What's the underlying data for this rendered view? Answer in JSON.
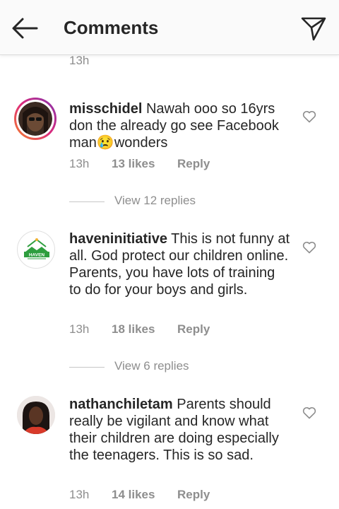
{
  "header": {
    "title": "Comments",
    "back_icon": "back-arrow-icon",
    "send_icon": "paper-plane-icon"
  },
  "top_item": {
    "time": "13h"
  },
  "comments": [
    {
      "username": "misschidel",
      "text_part1": "Nawah ooo so 16yrs don the already go see Facebook man",
      "emoji": "😢",
      "text_part2": "wonders",
      "time": "13h",
      "likes": "13 likes",
      "reply": "Reply",
      "view_replies": "View 12 replies"
    },
    {
      "username": "haveninitiative",
      "text": "This is not funny at all. God protect our children online. Parents, you have lots of training to do for your boys and girls.",
      "time": "13h",
      "likes": "18 likes",
      "reply": "Reply",
      "view_replies": "View 6 replies",
      "avatar_text": "HAVEN"
    },
    {
      "username": "nathanchiletam",
      "text": "Parents should really be vigilant and know what their children are doing especially the teenagers. This is so sad.",
      "time": "13h",
      "likes": "14 likes",
      "reply": "Reply"
    }
  ],
  "colors": {
    "text": "#262626",
    "meta": "#8e8e8e",
    "story_ring_start": "#f58529",
    "story_ring_end": "#dd2a7b",
    "haven_green": "#2e9e3e"
  }
}
